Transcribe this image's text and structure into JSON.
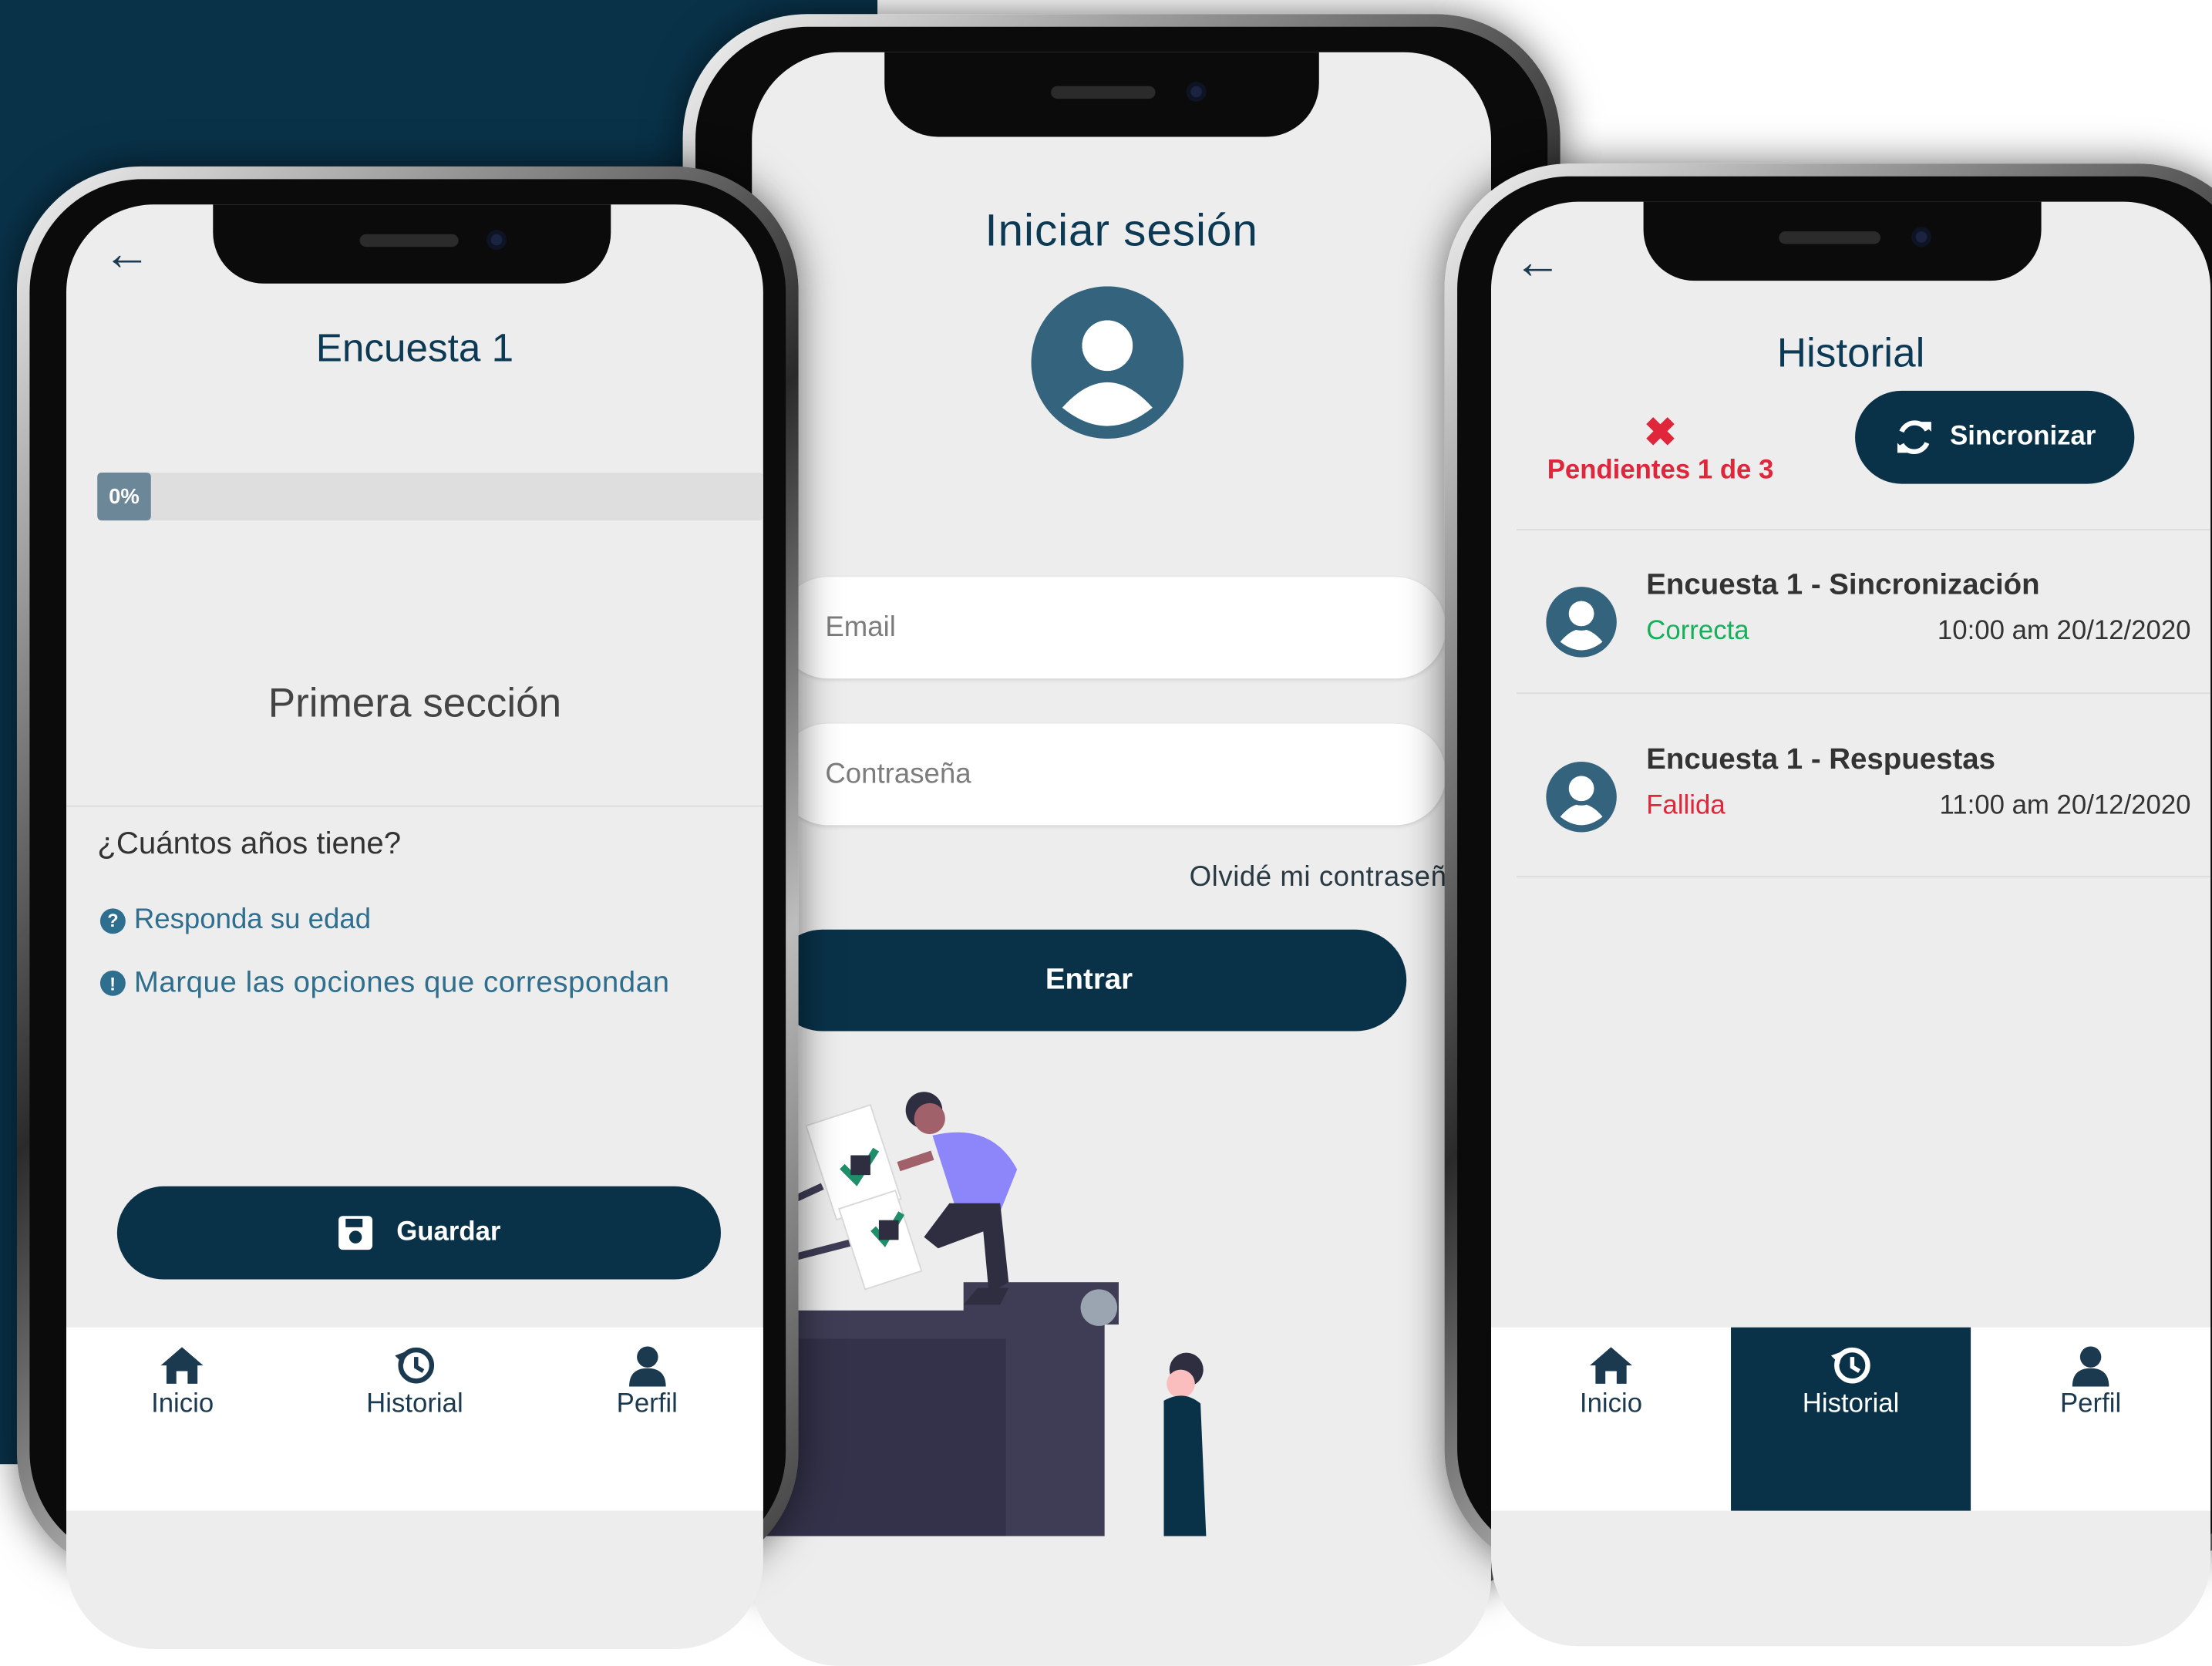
{
  "survey": {
    "title": "Encuesta 1",
    "progress_label": "0%",
    "progress": 0,
    "section_title": "Primera sección",
    "question": "¿Cuántos años tiene?",
    "hint_1": "Responda su edad",
    "hint_2": "Marque las opciones que correspondan",
    "save_label": "Guardar",
    "tabs": [
      {
        "label": "Inicio",
        "icon": "home-icon"
      },
      {
        "label": "Historial",
        "icon": "history-icon"
      },
      {
        "label": "Perfil",
        "icon": "user-icon"
      }
    ]
  },
  "login": {
    "title": "Iniciar sesión",
    "email_placeholder": "Email",
    "password_placeholder": "Contraseña",
    "forgot_label": "Olvidé mi contraseña",
    "submit_label": "Entrar"
  },
  "history": {
    "title": "Historial",
    "pending_label": "Pendientes 1 de 3",
    "sync_label": "Sincronizar",
    "items": [
      {
        "name": "Encuesta 1 - Sincronización",
        "status": "Correcta",
        "status_color": "#17b05a",
        "datetime": "10:00 am 20/12/2020"
      },
      {
        "name": "Encuesta 1 - Respuestas",
        "status": "Fallida",
        "status_color": "#e0263b",
        "datetime": "11:00 am 20/12/2020"
      }
    ],
    "tabs": [
      {
        "label": "Inicio",
        "icon": "home-icon"
      },
      {
        "label": "Historial",
        "icon": "history-icon",
        "active": true
      },
      {
        "label": "Perfil",
        "icon": "user-icon"
      }
    ]
  },
  "colors": {
    "brand_navy": "#093249",
    "title_blue": "#0c3a55",
    "hint_blue": "#2e6e8e",
    "error_red": "#e0263b",
    "success_green": "#17b05a"
  }
}
